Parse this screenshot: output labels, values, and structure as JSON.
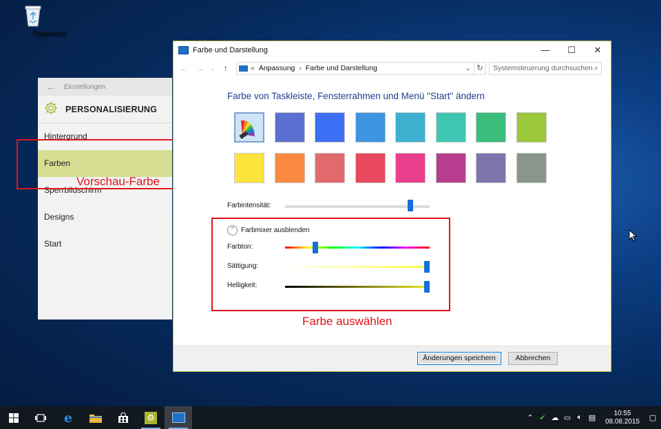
{
  "desktop": {
    "recycle_bin_label": "Papierkorb"
  },
  "settings": {
    "window_title": "Einstellungen",
    "header": "PERSONALISIERUNG",
    "nav": [
      {
        "label": "Hintergrund",
        "selected": false
      },
      {
        "label": "Farben",
        "selected": true
      },
      {
        "label": "Sperrbildschirm",
        "selected": false
      },
      {
        "label": "Designs",
        "selected": false
      },
      {
        "label": "Start",
        "selected": false
      }
    ],
    "accent_preview_color": "#d6de93"
  },
  "annotations": {
    "preview_label": "Vorschau-Farbe",
    "select_label": "Farbe auswählen",
    "color": "#e0141b"
  },
  "control_panel": {
    "window_title": "Farbe und Darstellung",
    "breadcrumb": [
      "Anpassung",
      "Farbe und Darstellung"
    ],
    "breadcrumb_prefix": "«",
    "search_placeholder": "Systemsteuerung durchsuchen",
    "heading": "Farbe von Taskleiste, Fensterrahmen und Menü \"Start\" ändern",
    "swatches_row1": [
      "custom",
      "#5a6fcf",
      "#3d6ff5",
      "#3f94e0",
      "#3eb0cf",
      "#3fc6b2",
      "#3bbd7c",
      "#9cc83c"
    ],
    "swatches_row2": [
      "#fde33c",
      "#fa8a42",
      "#e26a6d",
      "#e9485e",
      "#ea3f8c",
      "#b73d90",
      "#7f73ad",
      "#8a968c"
    ],
    "selected_swatch": 0,
    "intensity_label": "Farbintensität:",
    "intensity_value": 0.88,
    "mixer_toggle_label": "Farbmixer ausblenden",
    "hue_label": "Farbton:",
    "hue_value": 0.2,
    "saturation_label": "Sättigung:",
    "saturation_value": 1.0,
    "brightness_label": "Helligkeit:",
    "brightness_value": 1.0,
    "save_button": "Änderungen speichern",
    "cancel_button": "Abbrechen"
  },
  "taskbar": {
    "time": "10:55",
    "date": "08.08.2015"
  }
}
